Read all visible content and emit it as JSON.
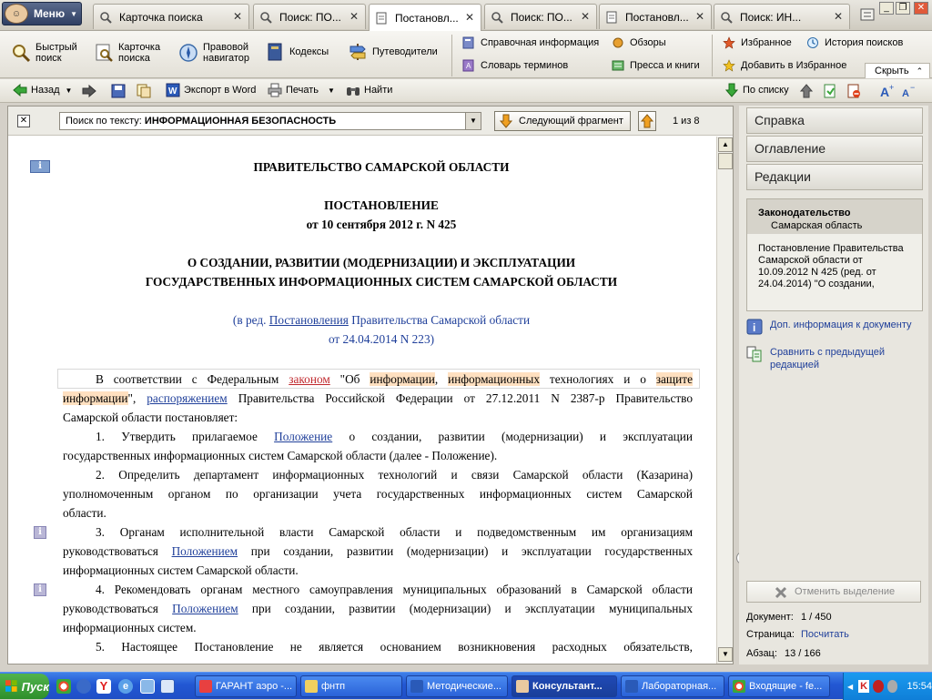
{
  "app": {
    "menu_label": "Меню"
  },
  "tabs": [
    {
      "label": "Карточка поиска",
      "active": false
    },
    {
      "label": "Поиск: ПО...",
      "active": false
    },
    {
      "label": "Постановл...",
      "active": true
    },
    {
      "label": "Поиск: ПО...",
      "active": false
    },
    {
      "label": "Постановл...",
      "active": false
    },
    {
      "label": "Поиск: ИН...",
      "active": false
    }
  ],
  "ribbon": {
    "quick_search": "Быстрый\nпоиск",
    "search_card": "Карточка\nпоиска",
    "legal_navigator": "Правовой\nнавигатор",
    "codes": "Кодексы",
    "guides": "Путеводители",
    "reference_info": "Справочная информация",
    "glossary": "Словарь терминов",
    "reviews": "Обзоры",
    "press_books": "Пресса и книги",
    "favorites": "Избранное",
    "add_favorites": "Добавить в Избранное",
    "search_history": "История поисков",
    "hide": "Скрыть"
  },
  "toolbar": {
    "back": "Назад",
    "export_word": "Экспорт в Word",
    "print": "Печать",
    "find": "Найти",
    "by_list": "По списку"
  },
  "search": {
    "prefix": "Поиск по тексту: ",
    "query": "ИНФОРМАЦИОННАЯ БЕЗОПАСНОСТЬ",
    "next_fragment": "Следующий фрагмент",
    "counter": "1 из 8"
  },
  "document": {
    "org": "ПРАВИТЕЛЬСТВО САМАРСКОЙ ОБЛАСТИ",
    "doc_type": "ПОСТАНОВЛЕНИЕ",
    "doc_date": "от 10 сентября 2012 г. N 425",
    "title_line1": "О СОЗДАНИИ, РАЗВИТИИ (МОДЕРНИЗАЦИИ) И ЭКСПЛУАТАЦИИ",
    "title_line2": "ГОСУДАРСТВЕННЫХ ИНФОРМАЦИОННЫХ СИСТЕМ САМАРСКОЙ ОБЛАСТИ",
    "rev_pre": "(в ред. ",
    "rev_link": "Постановления",
    "rev_post": " Правительства Самарской области",
    "rev_line2": "от 24.04.2014 N 223)",
    "p0": {
      "a": "В соответствии с Федеральным ",
      "link1": "законом",
      "b": " \"Об ",
      "h1": "информации",
      "c": ", ",
      "h2": "информационных",
      "d": " технологиях и о ",
      "h3": "защите",
      "h4": "информации",
      "e": "\", ",
      "link2": "распоряжением",
      "f": " Правительства Российской Федерации от 27.12.2011 N 2387-р Правительство",
      "g": "Самарской области постановляет:"
    },
    "p1": {
      "a": "1. Утвердить прилагаемое ",
      "link": "Положение",
      "b": " о создании, развитии (модернизации) и эксплуатации",
      "c": "государственных информационных систем Самарской области (далее - Положение)."
    },
    "p2": {
      "a": "2. Определить департамент информационных технологий и связи Самарской области (Казарина)",
      "b": "уполномоченным органом по организации учета государственных информационных систем Самарской",
      "c": "области."
    },
    "p3": {
      "a": "3. Органам исполнительной власти Самарской области и подведомственным им организациям",
      "b1": "руководствоваться ",
      "link": "Положением",
      "b2": " при создании, развитии (модернизации) и эксплуатации государственных",
      "c": "информационных систем Самарской области."
    },
    "p4": {
      "a": "4. Рекомендовать органам местного самоуправления муниципальных образований в Самарской области",
      "b1": "руководствоваться ",
      "link": "Положением",
      "b2": " при создании, развитии (модернизации) и эксплуатации муниципальных",
      "c": "информационных систем."
    },
    "p5": {
      "a": "5. Настоящее Постановление не является основанием возникновения расходных обязательств,"
    }
  },
  "right_panel": {
    "help": "Справка",
    "contents": "Оглавление",
    "editions": "Редакции",
    "legis_title": "Законодательство",
    "legis_region": "Самарская область",
    "legis_desc": "Постановление Правительства Самарской области от 10.09.2012 N 425 (ред. от 24.04.2014) \"О создании,",
    "extra_info": "Доп. информация к документу",
    "compare": "Сравнить с предыдущей редакцией",
    "cancel_selection": "Отменить выделение",
    "doc_label": "Документ:",
    "doc_value": "1 / 450",
    "page_label": "Страница:",
    "page_value": "Посчитать",
    "para_label": "Абзац:",
    "para_value": "13 / 166"
  },
  "taskbar": {
    "start": "Пуск",
    "tasks": [
      "ГАРАНТ аэро -...",
      "фнтп",
      "Методические...",
      "Консультант...",
      "Лабораторная...",
      "Входящие - fe..."
    ],
    "clock": "15:54"
  }
}
